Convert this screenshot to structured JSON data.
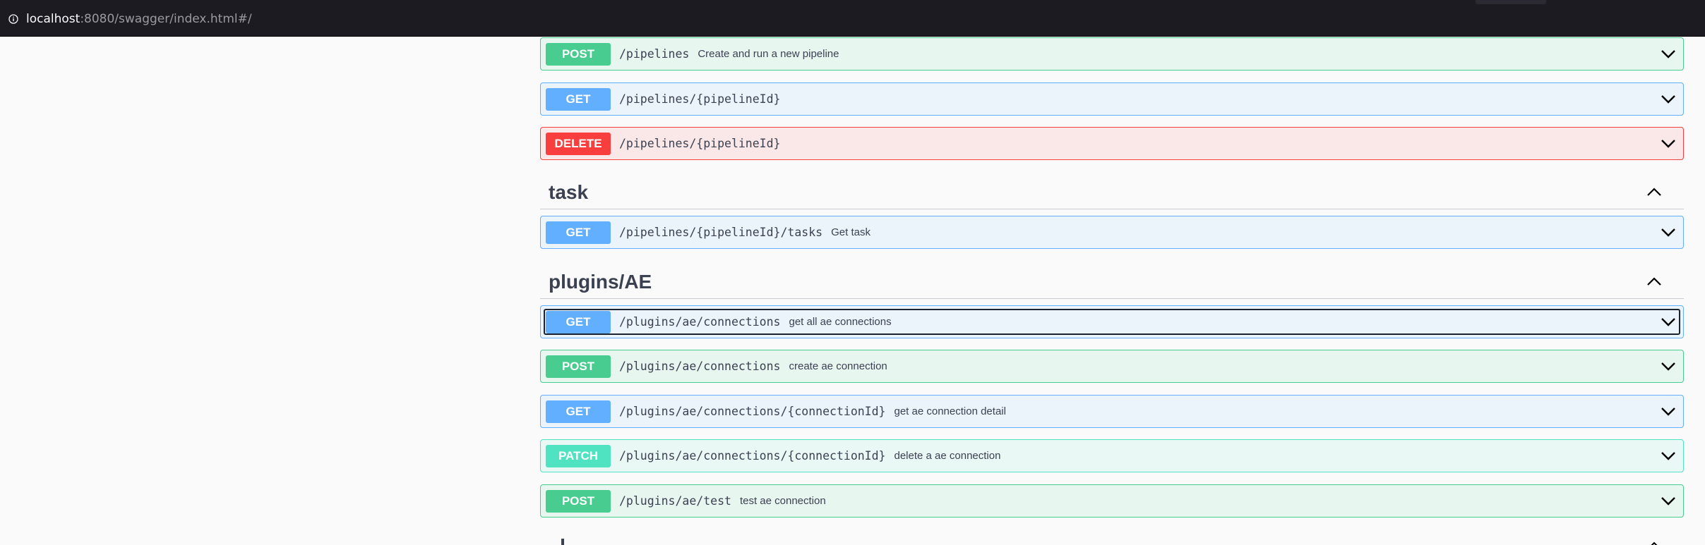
{
  "browser": {
    "url_host": "localhost",
    "url_rest": ":8080/swagger/index.html#/"
  },
  "colors": {
    "post": "#49cc90",
    "get": "#61affe",
    "delete": "#f93e3e",
    "patch": "#50e3c2"
  },
  "sections": {
    "pipelines_ops": [
      {
        "method": "POST",
        "path": "/pipelines",
        "summary": "Create and run a new pipeline"
      },
      {
        "method": "GET",
        "path": "/pipelines/{pipelineId}",
        "summary": ""
      },
      {
        "method": "DELETE",
        "path": "/pipelines/{pipelineId}",
        "summary": ""
      }
    ],
    "task": {
      "title": "task",
      "ops": [
        {
          "method": "GET",
          "path": "/pipelines/{pipelineId}/tasks",
          "summary": "Get task"
        }
      ]
    },
    "plugins_ae": {
      "title": "plugins/AE",
      "ops": [
        {
          "method": "GET",
          "path": "/plugins/ae/connections",
          "summary": "get all ae connections"
        },
        {
          "method": "POST",
          "path": "/plugins/ae/connections",
          "summary": "create ae connection"
        },
        {
          "method": "GET",
          "path": "/plugins/ae/connections/{connectionId}",
          "summary": "get ae connection detail"
        },
        {
          "method": "PATCH",
          "path": "/plugins/ae/connections/{connectionId}",
          "summary": "delete a ae connection"
        },
        {
          "method": "POST",
          "path": "/plugins/ae/test",
          "summary": "test ae connection"
        }
      ]
    }
  }
}
